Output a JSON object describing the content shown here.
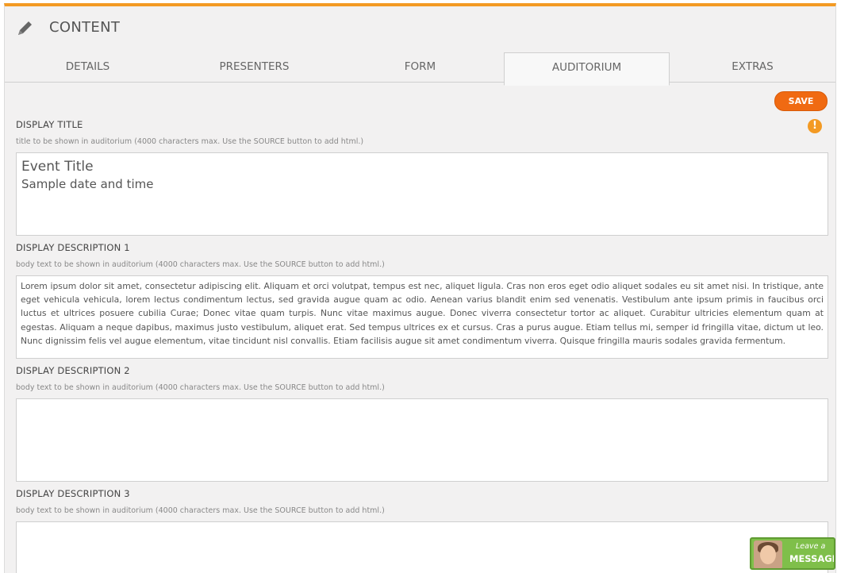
{
  "header": {
    "title": "CONTENT",
    "icon": "pencil-icon"
  },
  "tabs": [
    {
      "label": "DETAILS"
    },
    {
      "label": "PRESENTERS"
    },
    {
      "label": "FORM"
    },
    {
      "label": "AUDITORIUM",
      "active": true
    },
    {
      "label": "EXTRAS"
    }
  ],
  "toolbar": {
    "save_label": "SAVE",
    "warning": "!"
  },
  "display_title": {
    "label": "DISPLAY TITLE",
    "hint": "title to be shown in auditorium (4000 characters max. Use the SOURCE button to add html.)",
    "value_line1": "Event Title",
    "value_line2": "Sample date and time"
  },
  "description1": {
    "label": "DISPLAY DESCRIPTION 1",
    "hint": "body text to be shown in auditorium (4000 characters max. Use the SOURCE button to add html.)",
    "value": "Lorem ipsum dolor sit amet, consectetur adipiscing elit. Aliquam et orci volutpat, tempus est nec, aliquet ligula. Cras non eros eget odio aliquet sodales eu sit amet nisi. In tristique, ante eget vehicula vehicula, lorem lectus condimentum lectus, sed gravida augue quam ac odio. Aenean varius blandit enim sed venenatis. Vestibulum ante ipsum primis in faucibus orci luctus et ultrices posuere cubilia Curae; Donec vitae quam turpis. Nunc vitae maximus augue. Donec viverra consectetur tortor ac aliquet. Curabitur ultricies elementum quam at egestas. Aliquam a neque dapibus, maximus justo vestibulum, aliquet erat. Sed tempus ultrices ex et cursus. Cras a purus augue. Etiam tellus mi, semper id fringilla vitae, dictum ut leo. Nunc dignissim felis vel augue elementum, vitae tincidunt nisl convallis. Etiam facilisis augue sit amet condimentum viverra. Quisque fringilla mauris sodales gravida fermentum."
  },
  "description2": {
    "label": "DISPLAY DESCRIPTION 2",
    "hint": "body text to be shown in auditorium (4000 characters max. Use the SOURCE button to add html.)",
    "value": ""
  },
  "description3": {
    "label": "DISPLAY DESCRIPTION 3",
    "hint": "body text to be shown in auditorium (4000 characters max. Use the SOURCE button to add html.)",
    "value": ""
  },
  "chat_widget": {
    "line1": "Leave a",
    "line2": "MESSAGE"
  }
}
